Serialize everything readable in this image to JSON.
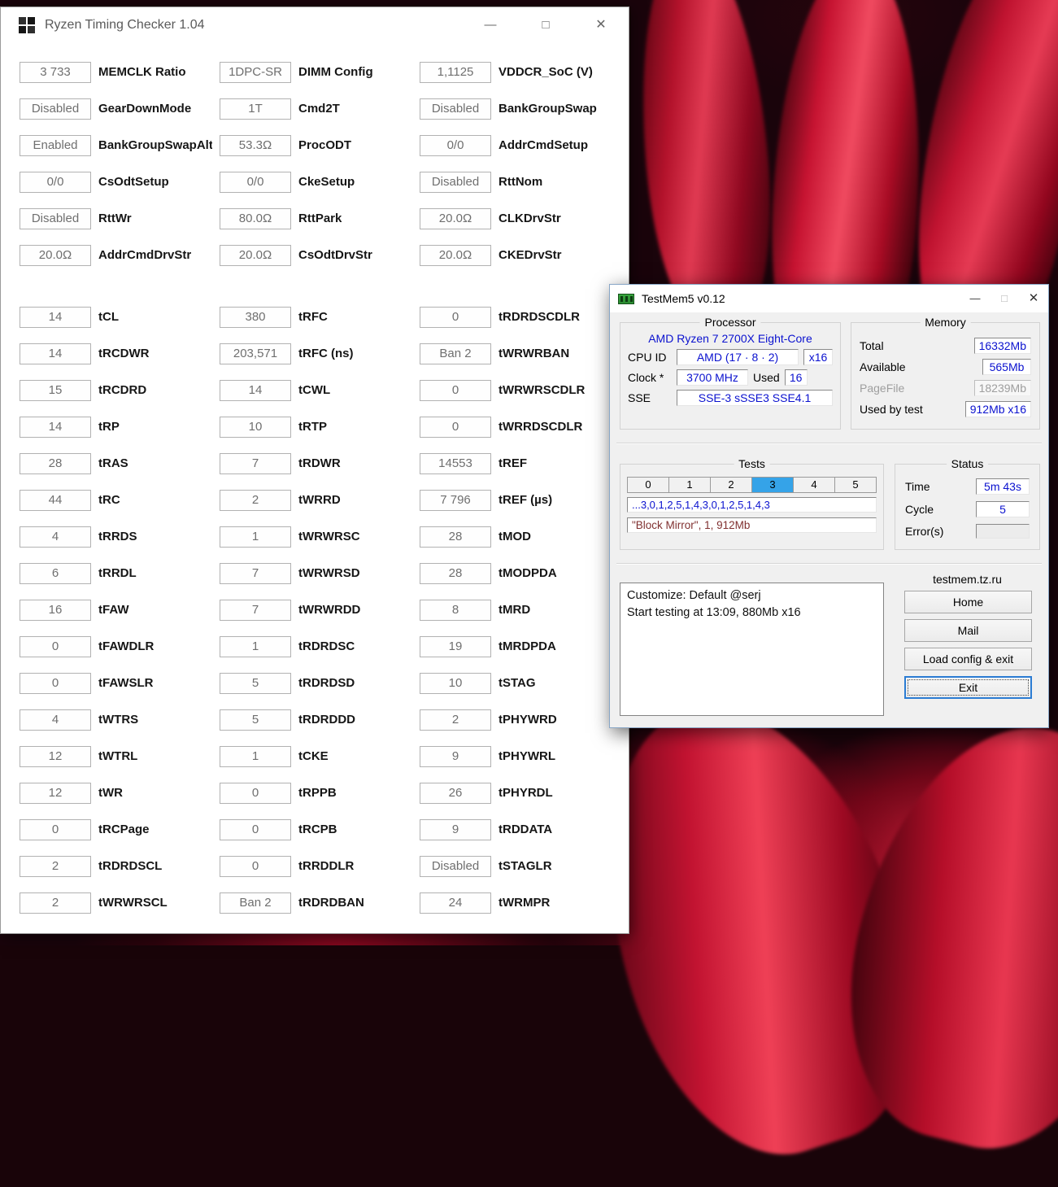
{
  "wallpaper": {
    "base_color": "#1a040b",
    "petal_color": "#c61331"
  },
  "rtc": {
    "title": "Ryzen Timing Checker 1.04",
    "controls": {
      "minimize": "—",
      "maximize": "□",
      "close": "✕"
    },
    "config_grid": [
      [
        "3 733",
        "MEMCLK Ratio",
        "1DPC-SR",
        "DIMM Config",
        "1,1125",
        "VDDCR_SoC (V)"
      ],
      [
        "Disabled",
        "GearDownMode",
        "1T",
        "Cmd2T",
        "Disabled",
        "BankGroupSwap"
      ],
      [
        "Enabled",
        "BankGroupSwapAlt",
        "53.3Ω",
        "ProcODT",
        "0/0",
        "AddrCmdSetup"
      ],
      [
        "0/0",
        "CsOdtSetup",
        "0/0",
        "CkeSetup",
        "Disabled",
        "RttNom"
      ],
      [
        "Disabled",
        "RttWr",
        "80.0Ω",
        "RttPark",
        "20.0Ω",
        "CLKDrvStr"
      ],
      [
        "20.0Ω",
        "AddrCmdDrvStr",
        "20.0Ω",
        "CsOdtDrvStr",
        "20.0Ω",
        "CKEDrvStr"
      ]
    ],
    "timing_grid": [
      [
        "14",
        "tCL",
        "380",
        "tRFC",
        "0",
        "tRDRDSCDLR"
      ],
      [
        "14",
        "tRCDWR",
        "203,571",
        "tRFC (ns)",
        "Ban 2",
        "tWRWRBAN"
      ],
      [
        "15",
        "tRCDRD",
        "14",
        "tCWL",
        "0",
        "tWRWRSCDLR"
      ],
      [
        "14",
        "tRP",
        "10",
        "tRTP",
        "0",
        "tWRRDSCDLR"
      ],
      [
        "28",
        "tRAS",
        "7",
        "tRDWR",
        "14553",
        "tREF"
      ],
      [
        "44",
        "tRC",
        "2",
        "tWRRD",
        "7 796",
        "tREF (µs)"
      ],
      [
        "4",
        "tRRDS",
        "1",
        "tWRWRSC",
        "28",
        "tMOD"
      ],
      [
        "6",
        "tRRDL",
        "7",
        "tWRWRSD",
        "28",
        "tMODPDA"
      ],
      [
        "16",
        "tFAW",
        "7",
        "tWRWRDD",
        "8",
        "tMRD"
      ],
      [
        "0",
        "tFAWDLR",
        "1",
        "tRDRDSC",
        "19",
        "tMRDPDA"
      ],
      [
        "0",
        "tFAWSLR",
        "5",
        "tRDRDSD",
        "10",
        "tSTAG"
      ],
      [
        "4",
        "tWTRS",
        "5",
        "tRDRDDD",
        "2",
        "tPHYWRD"
      ],
      [
        "12",
        "tWTRL",
        "1",
        "tCKE",
        "9",
        "tPHYWRL"
      ],
      [
        "12",
        "tWR",
        "0",
        "tRPPB",
        "26",
        "tPHYRDL"
      ],
      [
        "0",
        "tRCPage",
        "0",
        "tRCPB",
        "9",
        "tRDDATA"
      ],
      [
        "2",
        "tRDRDSCL",
        "0",
        "tRRDDLR",
        "Disabled",
        "tSTAGLR"
      ],
      [
        "2",
        "tWRWRSCL",
        "Ban 2",
        "tRDRDBAN",
        "24",
        "tWRMPR"
      ]
    ]
  },
  "tm5": {
    "title": "TestMem5 v0.12",
    "controls": {
      "minimize": "—",
      "maximize": "□",
      "close": "✕"
    },
    "processor": {
      "group_label": "Processor",
      "cpu_name": "AMD Ryzen 7 2700X Eight-Core",
      "cpu_id_label": "CPU ID",
      "cpu_id_vendor": "AMD  (17 · 8 · 2)",
      "cpu_id_count": "x16",
      "clock_label": "Clock *",
      "clock_value": "3700 MHz",
      "used_label": "Used",
      "used_value": "16",
      "sse_label": "SSE",
      "sse_value": "SSE-3 sSSE3 SSE4.1"
    },
    "memory": {
      "group_label": "Memory",
      "rows": [
        {
          "label": "Total",
          "value": "16332Mb",
          "dim": false
        },
        {
          "label": "Available",
          "value": "565Mb",
          "dim": false
        },
        {
          "label": "PageFile",
          "value": "18239Mb",
          "dim": true
        },
        {
          "label": "Used by test",
          "value": "912Mb x16",
          "dim": false
        }
      ]
    },
    "tests": {
      "group_label": "Tests",
      "cells": [
        "0",
        "1",
        "2",
        "3",
        "4",
        "5"
      ],
      "active_index": 3,
      "sequence": "...3,0,1,2,5,1,4,3,0,1,2,5,1,4,3",
      "current": "\"Block Mirror\", 1, 912Mb"
    },
    "status": {
      "group_label": "Status",
      "time_label": "Time",
      "time_value": "5m 43s",
      "cycle_label": "Cycle",
      "cycle_value": "5",
      "errors_label": "Error(s)",
      "errors_value": ""
    },
    "log_lines": [
      "Customize: Default @serj",
      "Start testing at 13:09, 880Mb x16"
    ],
    "site": "testmem.tz.ru",
    "buttons": [
      "Home",
      "Mail",
      "Load config & exit",
      "Exit"
    ]
  }
}
